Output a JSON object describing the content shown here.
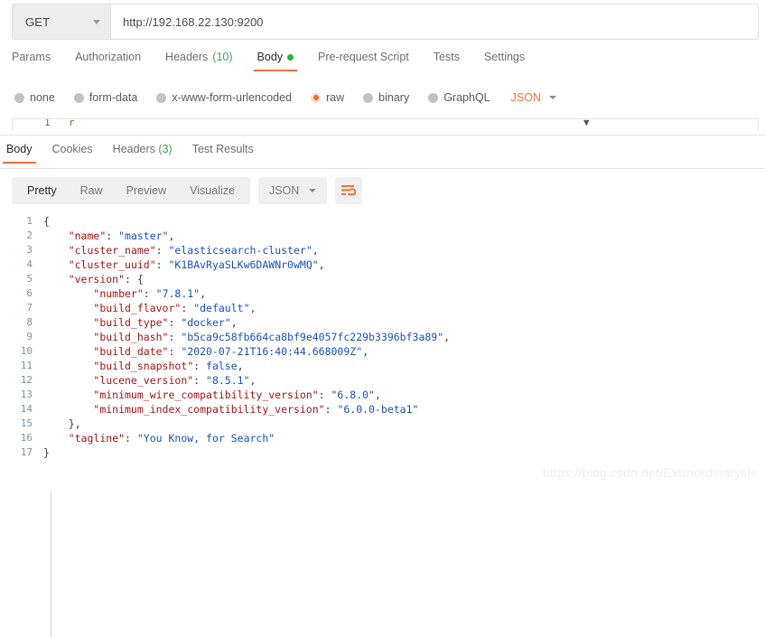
{
  "request": {
    "method": "GET",
    "url": "http://192.168.22.130:9200",
    "tabs": [
      {
        "label": "Params",
        "active": false
      },
      {
        "label": "Authorization",
        "active": false
      },
      {
        "label": "Headers",
        "count": "(10)",
        "active": false
      },
      {
        "label": "Body",
        "active": true,
        "dot": "green"
      },
      {
        "label": "Pre-request Script",
        "active": false
      },
      {
        "label": "Tests",
        "active": false
      },
      {
        "label": "Settings",
        "active": false
      }
    ],
    "body_types": [
      {
        "label": "none",
        "selected": false
      },
      {
        "label": "form-data",
        "selected": false
      },
      {
        "label": "x-www-form-urlencoded",
        "selected": false
      },
      {
        "label": "raw",
        "selected": true
      },
      {
        "label": "binary",
        "selected": false
      },
      {
        "label": "GraphQL",
        "selected": false
      }
    ],
    "raw_format": "JSON"
  },
  "response": {
    "tabs": [
      {
        "label": "Body",
        "active": true
      },
      {
        "label": "Cookies",
        "active": false
      },
      {
        "label": "Headers",
        "count": "(3)",
        "active": false
      },
      {
        "label": "Test Results",
        "active": false
      }
    ],
    "view_modes": [
      {
        "label": "Pretty",
        "active": true
      },
      {
        "label": "Raw",
        "active": false
      },
      {
        "label": "Preview",
        "active": false
      },
      {
        "label": "Visualize",
        "active": false
      }
    ],
    "content_type": "JSON",
    "wrap_icon": "word-wrap-icon",
    "code_lines": [
      {
        "n": "1",
        "tokens": [
          {
            "t": "p",
            "v": "{"
          }
        ]
      },
      {
        "n": "2",
        "tokens": [
          {
            "t": "p",
            "v": "    "
          },
          {
            "t": "k",
            "v": "\"name\""
          },
          {
            "t": "p",
            "v": ": "
          },
          {
            "t": "s",
            "v": "\"master\""
          },
          {
            "t": "p",
            "v": ","
          }
        ]
      },
      {
        "n": "3",
        "tokens": [
          {
            "t": "p",
            "v": "    "
          },
          {
            "t": "k",
            "v": "\"cluster_name\""
          },
          {
            "t": "p",
            "v": ": "
          },
          {
            "t": "s",
            "v": "\"elasticsearch-cluster\""
          },
          {
            "t": "p",
            "v": ","
          }
        ]
      },
      {
        "n": "4",
        "tokens": [
          {
            "t": "p",
            "v": "    "
          },
          {
            "t": "k",
            "v": "\"cluster_uuid\""
          },
          {
            "t": "p",
            "v": ": "
          },
          {
            "t": "s",
            "v": "\"K1BAvRyaSLKw6DAWNr0wMQ\""
          },
          {
            "t": "p",
            "v": ","
          }
        ]
      },
      {
        "n": "5",
        "tokens": [
          {
            "t": "p",
            "v": "    "
          },
          {
            "t": "k",
            "v": "\"version\""
          },
          {
            "t": "p",
            "v": ": {"
          }
        ]
      },
      {
        "n": "6",
        "tokens": [
          {
            "t": "p",
            "v": "        "
          },
          {
            "t": "k",
            "v": "\"number\""
          },
          {
            "t": "p",
            "v": ": "
          },
          {
            "t": "s",
            "v": "\"7.8.1\""
          },
          {
            "t": "p",
            "v": ","
          }
        ]
      },
      {
        "n": "7",
        "tokens": [
          {
            "t": "p",
            "v": "        "
          },
          {
            "t": "k",
            "v": "\"build_flavor\""
          },
          {
            "t": "p",
            "v": ": "
          },
          {
            "t": "s",
            "v": "\"default\""
          },
          {
            "t": "p",
            "v": ","
          }
        ]
      },
      {
        "n": "8",
        "tokens": [
          {
            "t": "p",
            "v": "        "
          },
          {
            "t": "k",
            "v": "\"build_type\""
          },
          {
            "t": "p",
            "v": ": "
          },
          {
            "t": "s",
            "v": "\"docker\""
          },
          {
            "t": "p",
            "v": ","
          }
        ]
      },
      {
        "n": "9",
        "tokens": [
          {
            "t": "p",
            "v": "        "
          },
          {
            "t": "k",
            "v": "\"build_hash\""
          },
          {
            "t": "p",
            "v": ": "
          },
          {
            "t": "s",
            "v": "\"b5ca9c58fb664ca8bf9e4057fc229b3396bf3a89\""
          },
          {
            "t": "p",
            "v": ","
          }
        ]
      },
      {
        "n": "10",
        "tokens": [
          {
            "t": "p",
            "v": "        "
          },
          {
            "t": "k",
            "v": "\"build_date\""
          },
          {
            "t": "p",
            "v": ": "
          },
          {
            "t": "s",
            "v": "\"2020-07-21T16:40:44.668009Z\""
          },
          {
            "t": "p",
            "v": ","
          }
        ]
      },
      {
        "n": "11",
        "tokens": [
          {
            "t": "p",
            "v": "        "
          },
          {
            "t": "k",
            "v": "\"build_snapshot\""
          },
          {
            "t": "p",
            "v": ": "
          },
          {
            "t": "s",
            "v": "false"
          },
          {
            "t": "p",
            "v": ","
          }
        ]
      },
      {
        "n": "12",
        "tokens": [
          {
            "t": "p",
            "v": "        "
          },
          {
            "t": "k",
            "v": "\"lucene_version\""
          },
          {
            "t": "p",
            "v": ": "
          },
          {
            "t": "s",
            "v": "\"8.5.1\""
          },
          {
            "t": "p",
            "v": ","
          }
        ]
      },
      {
        "n": "13",
        "tokens": [
          {
            "t": "p",
            "v": "        "
          },
          {
            "t": "k",
            "v": "\"minimum_wire_compatibility_version\""
          },
          {
            "t": "p",
            "v": ": "
          },
          {
            "t": "s",
            "v": "\"6.8.0\""
          },
          {
            "t": "p",
            "v": ","
          }
        ]
      },
      {
        "n": "14",
        "tokens": [
          {
            "t": "p",
            "v": "        "
          },
          {
            "t": "k",
            "v": "\"minimum_index_compatibility_version\""
          },
          {
            "t": "p",
            "v": ": "
          },
          {
            "t": "s",
            "v": "\"6.0.0-beta1\""
          }
        ]
      },
      {
        "n": "15",
        "tokens": [
          {
            "t": "p",
            "v": "    },"
          }
        ]
      },
      {
        "n": "16",
        "tokens": [
          {
            "t": "p",
            "v": "    "
          },
          {
            "t": "k",
            "v": "\"tagline\""
          },
          {
            "t": "p",
            "v": ": "
          },
          {
            "t": "s",
            "v": "\"You Know, for Search\""
          }
        ]
      },
      {
        "n": "17",
        "tokens": [
          {
            "t": "p",
            "v": "}"
          }
        ]
      }
    ]
  },
  "watermark": "https://blog.csdn.net/Extraordinarylife"
}
